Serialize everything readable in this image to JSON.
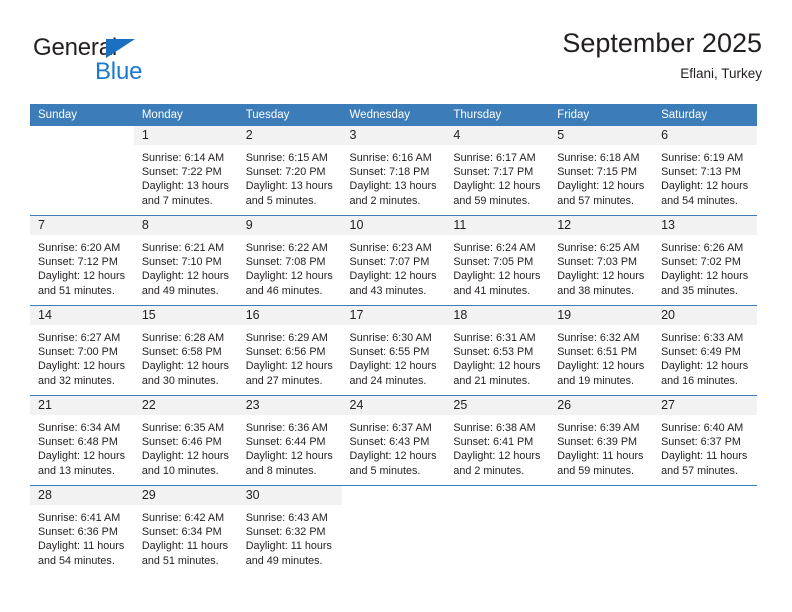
{
  "logo": {
    "text_dark": "General",
    "text_blue": "Blue",
    "triangle_color": "#1b6fc0",
    "blue_color": "#1b79cf"
  },
  "header": {
    "title": "September 2025",
    "subtitle": "Eflani, Turkey"
  },
  "colors": {
    "header_blue": "#3b7cb9",
    "daynum_band": "#f2f2f2",
    "text": "#231f20"
  },
  "weekday_headers": [
    "Sunday",
    "Monday",
    "Tuesday",
    "Wednesday",
    "Thursday",
    "Friday",
    "Saturday"
  ],
  "weeks": [
    [
      {
        "day": "",
        "blank": true,
        "lines": []
      },
      {
        "day": "1",
        "lines": [
          "Sunrise: 6:14 AM",
          "Sunset: 7:22 PM",
          "Daylight: 13 hours",
          "and 7 minutes."
        ]
      },
      {
        "day": "2",
        "lines": [
          "Sunrise: 6:15 AM",
          "Sunset: 7:20 PM",
          "Daylight: 13 hours",
          "and 5 minutes."
        ]
      },
      {
        "day": "3",
        "lines": [
          "Sunrise: 6:16 AM",
          "Sunset: 7:18 PM",
          "Daylight: 13 hours",
          "and 2 minutes."
        ]
      },
      {
        "day": "4",
        "lines": [
          "Sunrise: 6:17 AM",
          "Sunset: 7:17 PM",
          "Daylight: 12 hours",
          "and 59 minutes."
        ]
      },
      {
        "day": "5",
        "lines": [
          "Sunrise: 6:18 AM",
          "Sunset: 7:15 PM",
          "Daylight: 12 hours",
          "and 57 minutes."
        ]
      },
      {
        "day": "6",
        "lines": [
          "Sunrise: 6:19 AM",
          "Sunset: 7:13 PM",
          "Daylight: 12 hours",
          "and 54 minutes."
        ]
      }
    ],
    [
      {
        "day": "7",
        "lines": [
          "Sunrise: 6:20 AM",
          "Sunset: 7:12 PM",
          "Daylight: 12 hours",
          "and 51 minutes."
        ]
      },
      {
        "day": "8",
        "lines": [
          "Sunrise: 6:21 AM",
          "Sunset: 7:10 PM",
          "Daylight: 12 hours",
          "and 49 minutes."
        ]
      },
      {
        "day": "9",
        "lines": [
          "Sunrise: 6:22 AM",
          "Sunset: 7:08 PM",
          "Daylight: 12 hours",
          "and 46 minutes."
        ]
      },
      {
        "day": "10",
        "lines": [
          "Sunrise: 6:23 AM",
          "Sunset: 7:07 PM",
          "Daylight: 12 hours",
          "and 43 minutes."
        ]
      },
      {
        "day": "11",
        "lines": [
          "Sunrise: 6:24 AM",
          "Sunset: 7:05 PM",
          "Daylight: 12 hours",
          "and 41 minutes."
        ]
      },
      {
        "day": "12",
        "lines": [
          "Sunrise: 6:25 AM",
          "Sunset: 7:03 PM",
          "Daylight: 12 hours",
          "and 38 minutes."
        ]
      },
      {
        "day": "13",
        "lines": [
          "Sunrise: 6:26 AM",
          "Sunset: 7:02 PM",
          "Daylight: 12 hours",
          "and 35 minutes."
        ]
      }
    ],
    [
      {
        "day": "14",
        "lines": [
          "Sunrise: 6:27 AM",
          "Sunset: 7:00 PM",
          "Daylight: 12 hours",
          "and 32 minutes."
        ]
      },
      {
        "day": "15",
        "lines": [
          "Sunrise: 6:28 AM",
          "Sunset: 6:58 PM",
          "Daylight: 12 hours",
          "and 30 minutes."
        ]
      },
      {
        "day": "16",
        "lines": [
          "Sunrise: 6:29 AM",
          "Sunset: 6:56 PM",
          "Daylight: 12 hours",
          "and 27 minutes."
        ]
      },
      {
        "day": "17",
        "lines": [
          "Sunrise: 6:30 AM",
          "Sunset: 6:55 PM",
          "Daylight: 12 hours",
          "and 24 minutes."
        ]
      },
      {
        "day": "18",
        "lines": [
          "Sunrise: 6:31 AM",
          "Sunset: 6:53 PM",
          "Daylight: 12 hours",
          "and 21 minutes."
        ]
      },
      {
        "day": "19",
        "lines": [
          "Sunrise: 6:32 AM",
          "Sunset: 6:51 PM",
          "Daylight: 12 hours",
          "and 19 minutes."
        ]
      },
      {
        "day": "20",
        "lines": [
          "Sunrise: 6:33 AM",
          "Sunset: 6:49 PM",
          "Daylight: 12 hours",
          "and 16 minutes."
        ]
      }
    ],
    [
      {
        "day": "21",
        "lines": [
          "Sunrise: 6:34 AM",
          "Sunset: 6:48 PM",
          "Daylight: 12 hours",
          "and 13 minutes."
        ]
      },
      {
        "day": "22",
        "lines": [
          "Sunrise: 6:35 AM",
          "Sunset: 6:46 PM",
          "Daylight: 12 hours",
          "and 10 minutes."
        ]
      },
      {
        "day": "23",
        "lines": [
          "Sunrise: 6:36 AM",
          "Sunset: 6:44 PM",
          "Daylight: 12 hours",
          "and 8 minutes."
        ]
      },
      {
        "day": "24",
        "lines": [
          "Sunrise: 6:37 AM",
          "Sunset: 6:43 PM",
          "Daylight: 12 hours",
          "and 5 minutes."
        ]
      },
      {
        "day": "25",
        "lines": [
          "Sunrise: 6:38 AM",
          "Sunset: 6:41 PM",
          "Daylight: 12 hours",
          "and 2 minutes."
        ]
      },
      {
        "day": "26",
        "lines": [
          "Sunrise: 6:39 AM",
          "Sunset: 6:39 PM",
          "Daylight: 11 hours",
          "and 59 minutes."
        ]
      },
      {
        "day": "27",
        "lines": [
          "Sunrise: 6:40 AM",
          "Sunset: 6:37 PM",
          "Daylight: 11 hours",
          "and 57 minutes."
        ]
      }
    ],
    [
      {
        "day": "28",
        "lines": [
          "Sunrise: 6:41 AM",
          "Sunset: 6:36 PM",
          "Daylight: 11 hours",
          "and 54 minutes."
        ]
      },
      {
        "day": "29",
        "lines": [
          "Sunrise: 6:42 AM",
          "Sunset: 6:34 PM",
          "Daylight: 11 hours",
          "and 51 minutes."
        ]
      },
      {
        "day": "30",
        "lines": [
          "Sunrise: 6:43 AM",
          "Sunset: 6:32 PM",
          "Daylight: 11 hours",
          "and 49 minutes."
        ]
      },
      {
        "day": "",
        "blank": true,
        "lines": []
      },
      {
        "day": "",
        "blank": true,
        "lines": []
      },
      {
        "day": "",
        "blank": true,
        "lines": []
      },
      {
        "day": "",
        "blank": true,
        "lines": []
      }
    ]
  ]
}
